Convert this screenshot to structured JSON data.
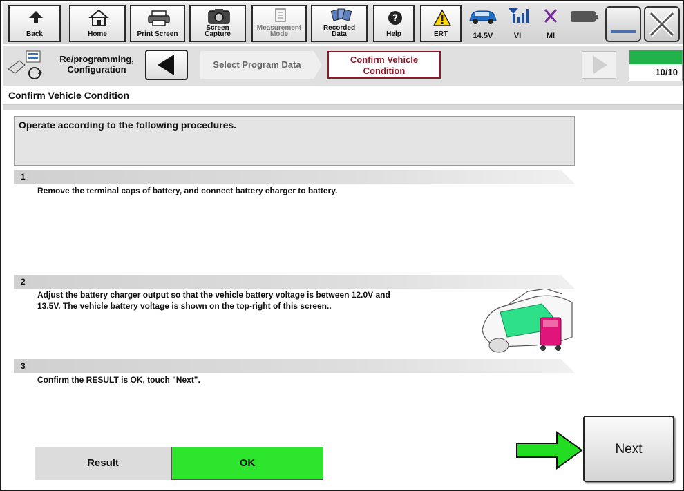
{
  "toolbar": {
    "back": "Back",
    "home": "Home",
    "print_screen": "Print Screen",
    "screen_capture_1": "Screen",
    "screen_capture_2": "Capture",
    "measurement_1": "Measurement",
    "measurement_2": "Mode",
    "recorded_1": "Recorded",
    "recorded_2": "Data",
    "help": "Help",
    "ert": "ERT",
    "voltage": "14.5V",
    "vi": "VI",
    "mi": "MI"
  },
  "nav": {
    "module_1": "Re/programming,",
    "module_2": "Configuration",
    "step_prev": "Select Program Data",
    "step_current_1": "Confirm Vehicle",
    "step_current_2": "Condition",
    "progress_label": "10/10",
    "progress_fraction": 1.0
  },
  "page": {
    "title": "Confirm Vehicle Condition",
    "instruction": "Operate according to the following procedures."
  },
  "steps": [
    {
      "number": "1",
      "text_1": "Remove the terminal caps of battery, and connect battery charger to battery.",
      "text_2": ""
    },
    {
      "number": "2",
      "text_1": "Adjust the battery charger output so that the vehicle battery voltage is between 12.0V and",
      "text_2": "13.5V. The vehicle battery voltage is shown on the top-right of this screen.."
    },
    {
      "number": "3",
      "text_1": "Confirm the RESULT is OK, touch \"Next\".",
      "text_2": ""
    }
  ],
  "result": {
    "label": "Result",
    "value": "OK"
  },
  "next_label": "Next",
  "colors": {
    "ok_green": "#2ee52e",
    "progress_green": "#22b24c",
    "current_step": "#8b1a2b",
    "arrow_green": "#22dd22"
  },
  "icons": [
    "back-arrow-icon",
    "home-icon",
    "printer-icon",
    "camera-icon",
    "measurement-icon",
    "recorded-data-icon",
    "help-icon",
    "warning-icon",
    "car-icon",
    "signal-icon",
    "mi-x-icon",
    "battery-icon",
    "minimize-icon",
    "close-icon"
  ]
}
